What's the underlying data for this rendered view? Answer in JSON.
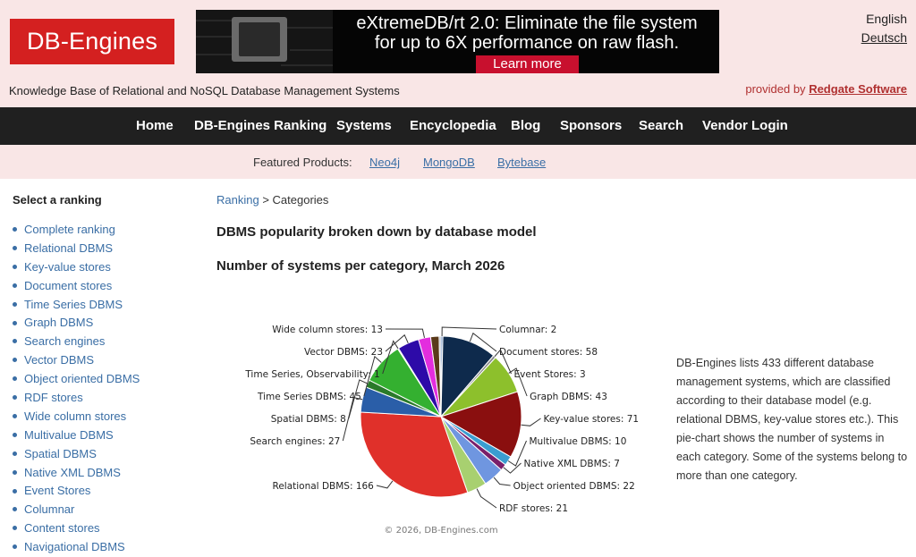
{
  "header": {
    "logo": "DB-Engines",
    "banner": {
      "line1": "eXtremeDB/rt 2.0: Eliminate the file system",
      "line2": "for up to 6X performance on raw flash.",
      "cta": "Learn more"
    },
    "languages": [
      "English",
      "Deutsch"
    ],
    "tagline": "Knowledge Base of Relational and NoSQL Database Management Systems",
    "provided_prefix": "provided by",
    "provided_by": "Redgate Software"
  },
  "nav": [
    "Home",
    "DB-Engines Ranking",
    "Systems",
    "Encyclopedia",
    "Blog",
    "Sponsors",
    "Search",
    "Vendor Login"
  ],
  "featured": {
    "label": "Featured Products:",
    "products": [
      "Neo4j",
      "MongoDB",
      "Bytebase"
    ]
  },
  "sidebar": {
    "title": "Select a ranking",
    "items": [
      "Complete ranking",
      "Relational DBMS",
      "Key-value stores",
      "Document stores",
      "Time Series DBMS",
      "Graph DBMS",
      "Search engines",
      "Vector DBMS",
      "Object oriented DBMS",
      "RDF stores",
      "Wide column stores",
      "Multivalue DBMS",
      "Spatial DBMS",
      "Native XML DBMS",
      "Event Stores",
      "Columnar",
      "Content stores",
      "Navigational DBMS"
    ]
  },
  "main": {
    "breadcrumb_link": "Ranking",
    "breadcrumb_rest": "> Categories",
    "title": "DBMS popularity broken down by database model",
    "subtitle": "Number of systems per category, March 2026",
    "copyright": "© 2026, DB-Engines.com",
    "description": "DB-Engines lists 433 different database management systems, which are classified according to their database model (e.g. relational DBMS, key-value stores etc.). This pie-chart shows the number of systems in each category. Some of the systems belong to more than one category."
  },
  "chart_data": {
    "type": "pie",
    "title": "Number of systems per category, March 2026",
    "slices": [
      {
        "label": "Columnar",
        "value": 2,
        "color": "#6a8cc0"
      },
      {
        "label": "Document stores",
        "value": 58,
        "color": "#0e2a4c"
      },
      {
        "label": "Event Stores",
        "value": 3,
        "color": "#8a8a8a"
      },
      {
        "label": "Graph DBMS",
        "value": 43,
        "color": "#8dc02c"
      },
      {
        "label": "Key-value stores",
        "value": 71,
        "color": "#8a0f0f"
      },
      {
        "label": "Multivalue DBMS",
        "value": 10,
        "color": "#3a9dd0"
      },
      {
        "label": "Native XML DBMS",
        "value": 7,
        "color": "#7a1f6a"
      },
      {
        "label": "Object oriented DBMS",
        "value": 22,
        "color": "#6f96e0"
      },
      {
        "label": "RDF stores",
        "value": 21,
        "color": "#a8d070"
      },
      {
        "label": "Relational DBMS",
        "value": 166,
        "color": "#e0302a"
      },
      {
        "label": "Search engines",
        "value": 27,
        "color": "#2a5ea8"
      },
      {
        "label": "Spatial DBMS",
        "value": 8,
        "color": "#2a7a2a"
      },
      {
        "label": "Time Series DBMS",
        "value": 45,
        "color": "#34b030"
      },
      {
        "label": "Time Series, Observability",
        "value": 1,
        "color": "#b8c8e8"
      },
      {
        "label": "Vector DBMS",
        "value": 23,
        "color": "#2d0aa8"
      },
      {
        "label": "Wide column stores",
        "value": 13,
        "color": "#e32dde"
      },
      {
        "label": "Content stores",
        "value": 9,
        "color": "#5a3a1a"
      },
      {
        "label": "Navigational DBMS",
        "value": 2,
        "color": "#b0b8c8"
      }
    ]
  }
}
